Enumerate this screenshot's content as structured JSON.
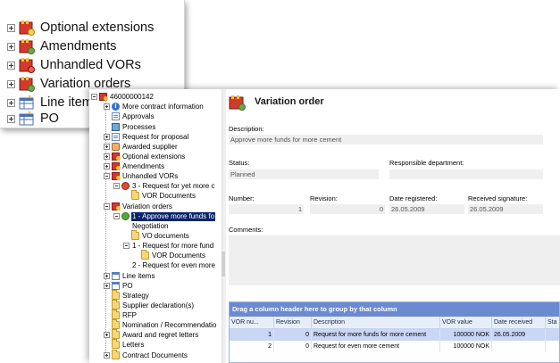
{
  "zoom_callout": {
    "items": [
      {
        "label": "Optional extensions",
        "icon": "awarded-extension-icon"
      },
      {
        "label": "Amendments",
        "icon": "amendment-icon"
      },
      {
        "label": "Unhandled VORs",
        "icon": "vor-icon"
      },
      {
        "label": "Variation orders",
        "icon": "variation-order-icon"
      },
      {
        "label": "Line item",
        "icon": "line-items-icon"
      },
      {
        "label": "PO",
        "icon": "po-icon"
      }
    ]
  },
  "tree": {
    "root": "46000000142",
    "items": [
      {
        "label": "More contract information"
      },
      {
        "label": "Approvals"
      },
      {
        "label": "Processes"
      },
      {
        "label": "Request for proposal"
      },
      {
        "label": "Awarded supplier"
      },
      {
        "label": "Optional extensions"
      },
      {
        "label": "Amendments"
      },
      {
        "label": "Unhandled VORs"
      },
      {
        "label": "3 - Request for yet more c"
      },
      {
        "label": "VOR Documents"
      },
      {
        "label": "Variation orders"
      },
      {
        "label": "1 - Approve more funds fo"
      },
      {
        "label": "Negotiation"
      },
      {
        "label": "VO documents"
      },
      {
        "label": "1 - Request for more fund"
      },
      {
        "label": "VOR Documents"
      },
      {
        "label": "2 - Request for even more"
      },
      {
        "label": "Line items"
      },
      {
        "label": "PO"
      },
      {
        "label": "Strategy"
      },
      {
        "label": "Supplier declaration(s)"
      },
      {
        "label": "RFP"
      },
      {
        "label": "Nomination / Recommendatio"
      },
      {
        "label": "Award and regret  letters"
      },
      {
        "label": "Letters"
      },
      {
        "label": "Contract Documents"
      }
    ]
  },
  "detail": {
    "title": "Variation order",
    "description_label": "Description:",
    "description_value": "Approve more funds for more cement",
    "status_label": "Status:",
    "status_value": "Planned",
    "department_label": "Responsible department:",
    "department_value": "",
    "number_label": "Number:",
    "number_value": "1",
    "revision_label": "Revision:",
    "revision_value": "0",
    "date_registered_label": "Date registered:",
    "date_registered_value": "26.05.2009",
    "received_signature_label": "Received signature:",
    "received_signature_value": "26.05.2009",
    "comments_label": "Comments:"
  },
  "grid": {
    "group_hint": "Drag a column header here to group by that column",
    "columns": [
      "VOR nu...",
      "Revision",
      "Description",
      "VOR value",
      "Date received",
      "Sta"
    ],
    "rows": [
      {
        "vor": "1",
        "revision": "0",
        "description": "Request for more funds for more cement",
        "value": "100000 NOK",
        "date": "26.05.2009",
        "status": ""
      },
      {
        "vor": "2",
        "revision": "0",
        "description": "Request for even more cement",
        "value": "100000 NOK",
        "date": "",
        "status": ""
      }
    ]
  }
}
